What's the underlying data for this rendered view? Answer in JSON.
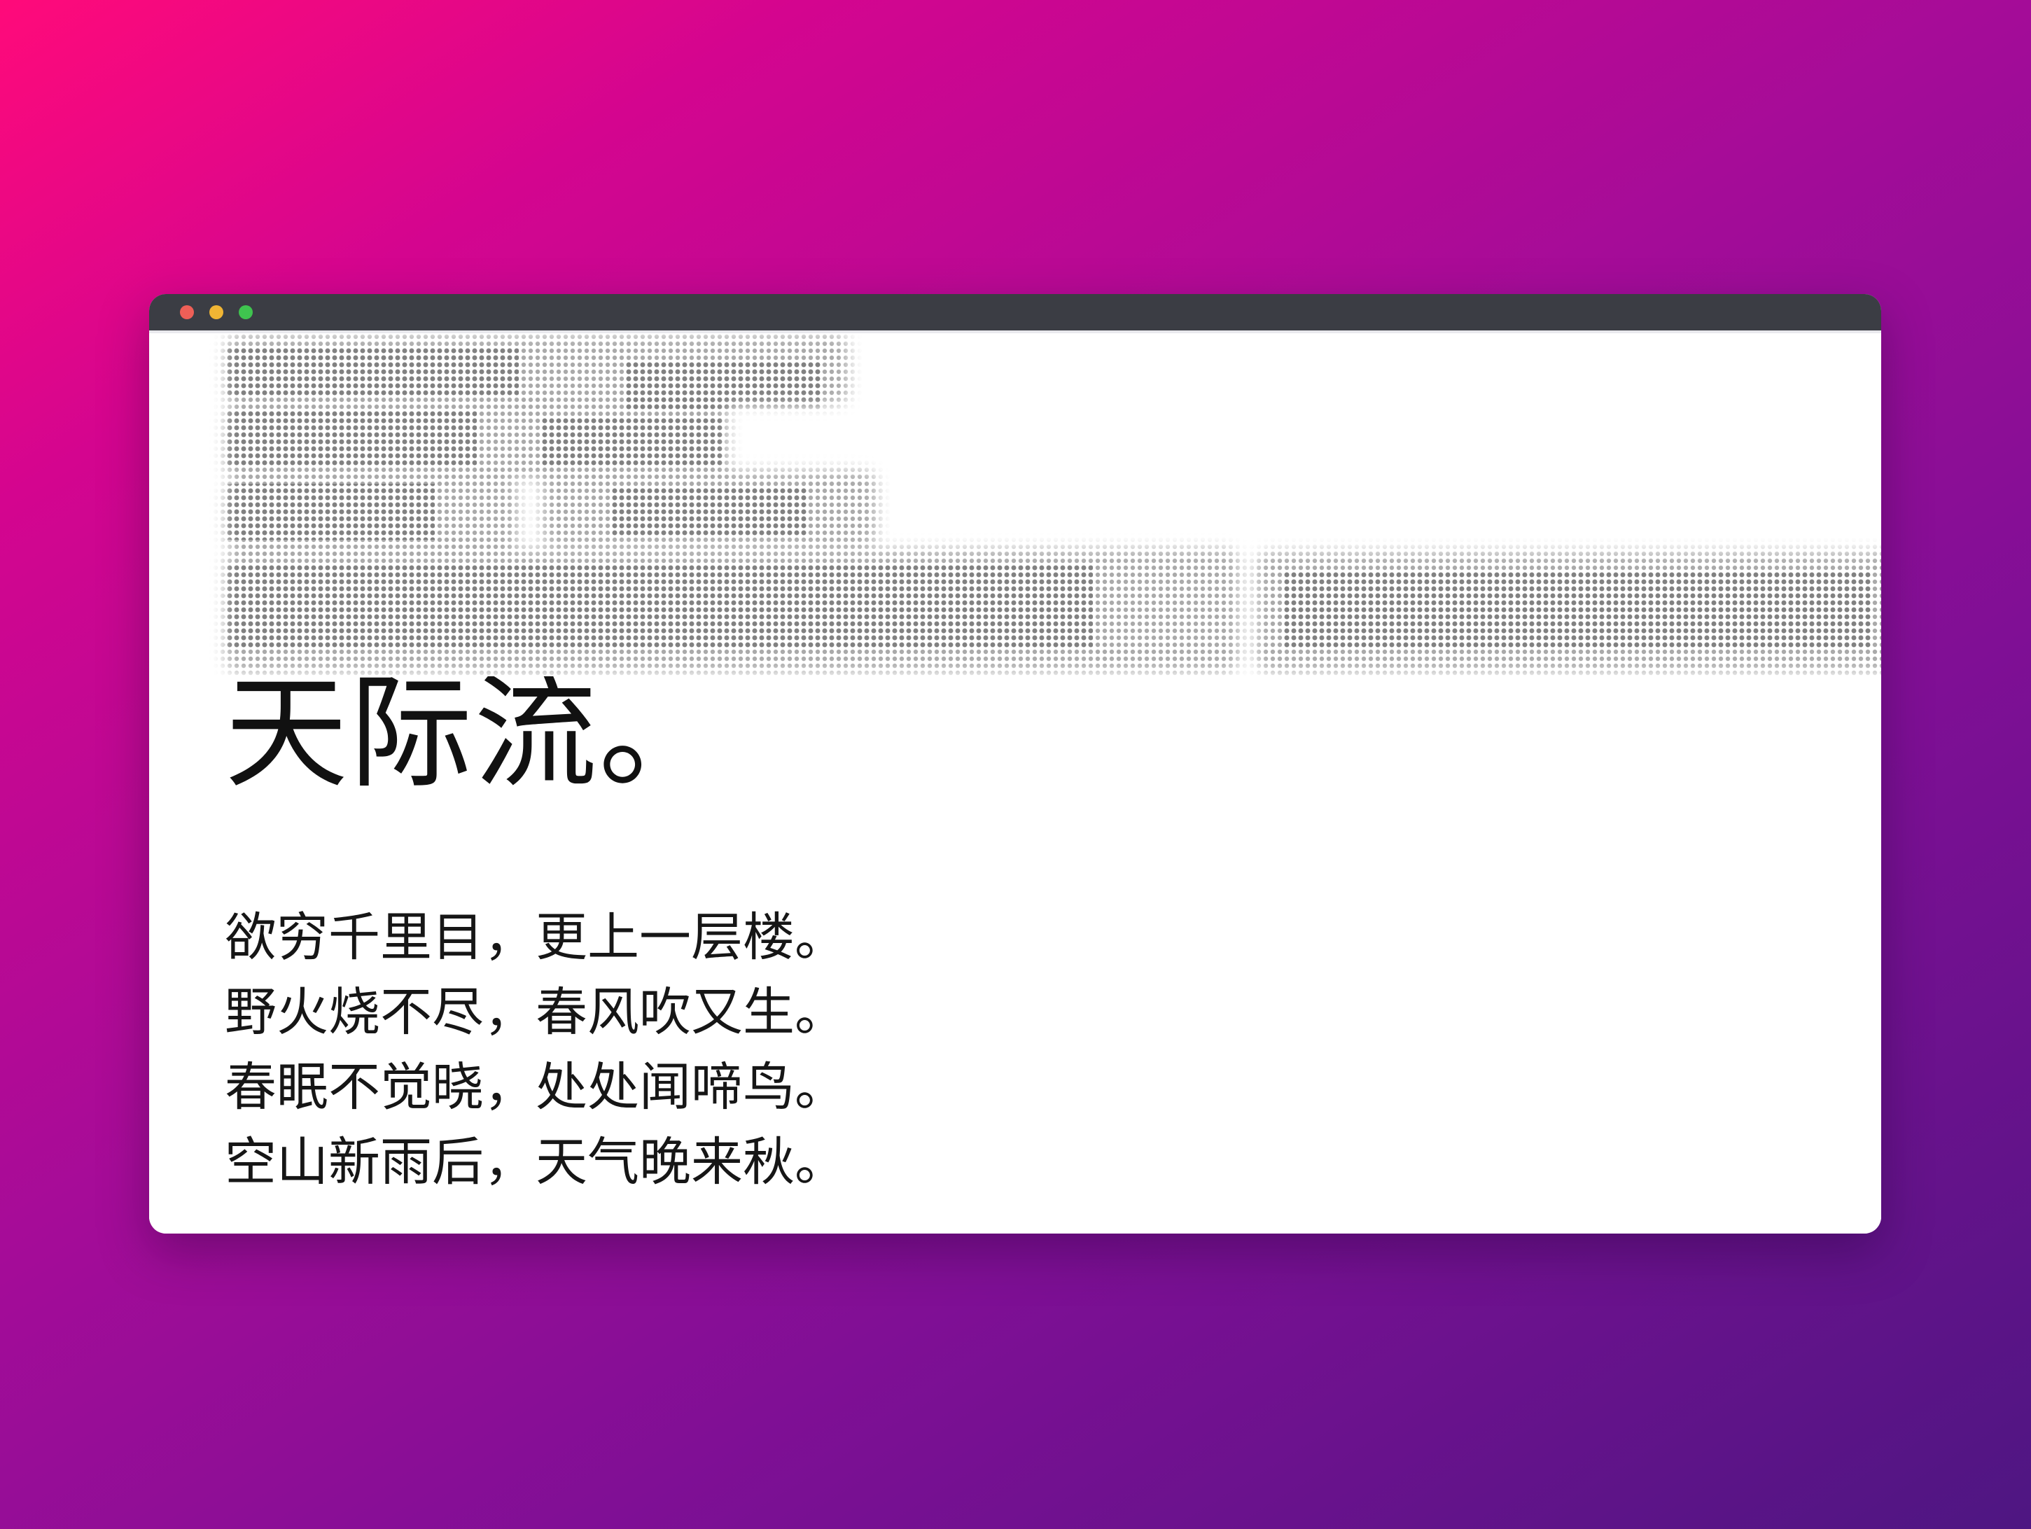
{
  "colors": {
    "background_start": "#ff0a7a",
    "background_end": "#4e1682",
    "title_bar": "#3b3d44",
    "close": "#ee5f57",
    "minimize": "#f0b534",
    "zoom": "#3fc44f",
    "text": "#111111"
  },
  "window": {
    "controls": [
      "close",
      "minimize",
      "zoom"
    ]
  },
  "content": {
    "headline": "孤帆远影碧空尽，唯见长江天际流。",
    "poem_lines": [
      "欲穷千里目，更上一层楼。",
      "野火烧不尽，春风吹又生。",
      "春眠不觉晓，处处闻啼鸟。",
      "空山新雨后，天气晚来秋。"
    ]
  }
}
